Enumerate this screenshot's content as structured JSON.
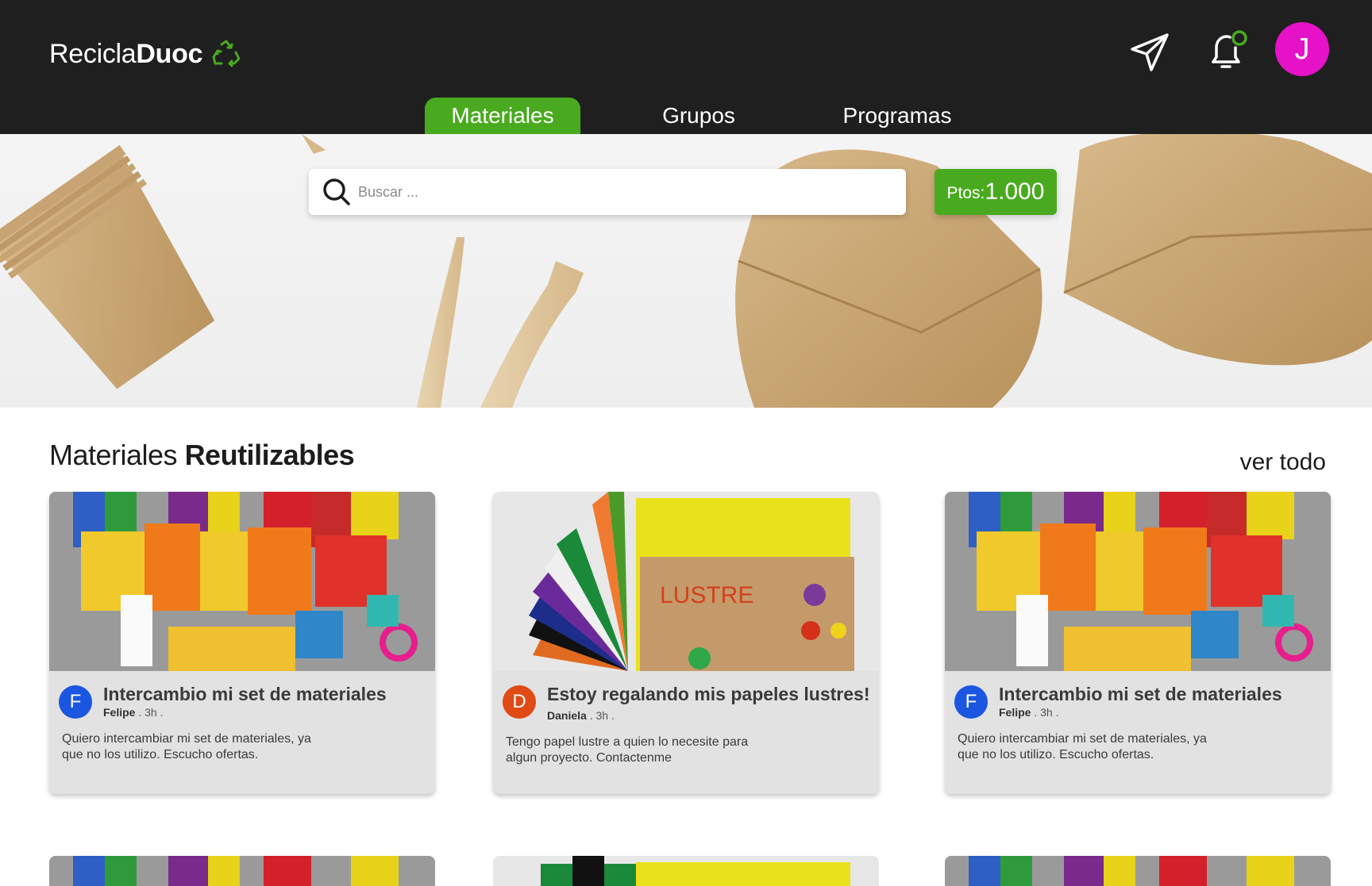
{
  "header": {
    "logo_light": "Recicla",
    "logo_bold": "Duoc",
    "logo_icon": "recycle-icon",
    "send_icon": "send-icon",
    "bell_icon": "bell-icon",
    "avatar_initial": "J",
    "avatar_color": "#e512c8"
  },
  "tabs": [
    {
      "label": "Materiales",
      "active": true
    },
    {
      "label": "Grupos",
      "active": false
    },
    {
      "label": "Programas",
      "active": false
    }
  ],
  "search": {
    "placeholder": "Buscar ..."
  },
  "points": {
    "label": "Ptos:",
    "value": "1.000"
  },
  "section": {
    "title_light": "Materiales ",
    "title_bold": "Reutilizables",
    "see_all": "ver todo"
  },
  "cards": [
    {
      "title": "Intercambio mi set de materiales",
      "author": "Felipe",
      "time": "3h .",
      "initial": "F",
      "avatar_color": "#1a56e0",
      "body": "Quiero intercambiar mi set de materiales, ya que no los utilizo. Escucho ofertas.",
      "image": "school-supplies"
    },
    {
      "title": "Estoy regalando mis papeles lustres!",
      "author": "Daniela",
      "time": "3h .",
      "initial": "D",
      "avatar_color": "#e04a14",
      "body": "Tengo papel lustre a quien lo necesite para algun proyecto. Contactenme",
      "image": "lustre-paper"
    },
    {
      "title": "Intercambio mi set de materiales",
      "author": "Felipe",
      "time": "3h .",
      "initial": "F",
      "avatar_color": "#1a56e0",
      "body": "Quiero intercambiar mi set de materiales, ya que no los utilizo. Escucho ofertas.",
      "image": "school-supplies"
    }
  ],
  "colors": {
    "accent": "#4aaa1f",
    "header_bg": "#1f1f1f",
    "card_bg": "#e2e2e2"
  }
}
